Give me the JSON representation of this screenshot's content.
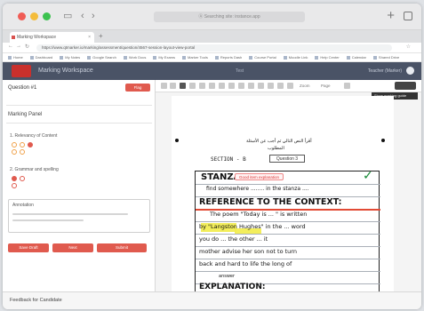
{
  "browser": {
    "url_short": "Ⓐ  Searching site: instance.app",
    "tab_title": "Marking Workspace",
    "address": "https://www.qtmarker.io/marking/assessment/question/4567-session-layout-view-portal",
    "bookmarks": [
      "Home",
      "Dashboard",
      "My Notes",
      "Google Search",
      "Work Docs",
      "My Exams",
      "Marker Tools",
      "Reports Dash",
      "Course Portal",
      "Moodle Link",
      "Help Center",
      "Calendar",
      "Shared Drive"
    ]
  },
  "app": {
    "name": "Marking Workspace",
    "center_label": "Test",
    "user": "Teacher (Marker)"
  },
  "left": {
    "question_title": "Question #1",
    "question_button": "Flag",
    "marking_panel_title": "Marking Panel",
    "criteria": [
      {
        "label": "1. Relevancy of Content"
      },
      {
        "label": "2. Grammar and spelling"
      }
    ],
    "notes_title": "Annotation",
    "action_buttons": [
      "Save Draft",
      "Next",
      "Submit"
    ]
  },
  "viewer": {
    "toolbar_label_a": "Zoom",
    "toolbar_label_b": "Page",
    "tooltip": "Show marking guide",
    "arabic_line1": "أقرأ النص التالي ثم أجب عن الأسئلة",
    "arabic_line2": "المطلوب",
    "section_label": "SECTION - B",
    "question_box": "Question 3",
    "feedback_tag": "Good item explanation",
    "handwriting": [
      "STANZA",
      "find somewhere ........ in the stanza ....",
      "REFERENCE TO THE CONTEXT:",
      "The poem \"Today is ... \" is written",
      "by \"Langston Hughes\" in the ... word",
      "you do ... the other ... it",
      "mother advise her son not to turn",
      "back and hard to life the long of",
      "answer",
      "EXPLANATION:"
    ]
  },
  "footer": {
    "title": "Feedback for Candidate"
  }
}
